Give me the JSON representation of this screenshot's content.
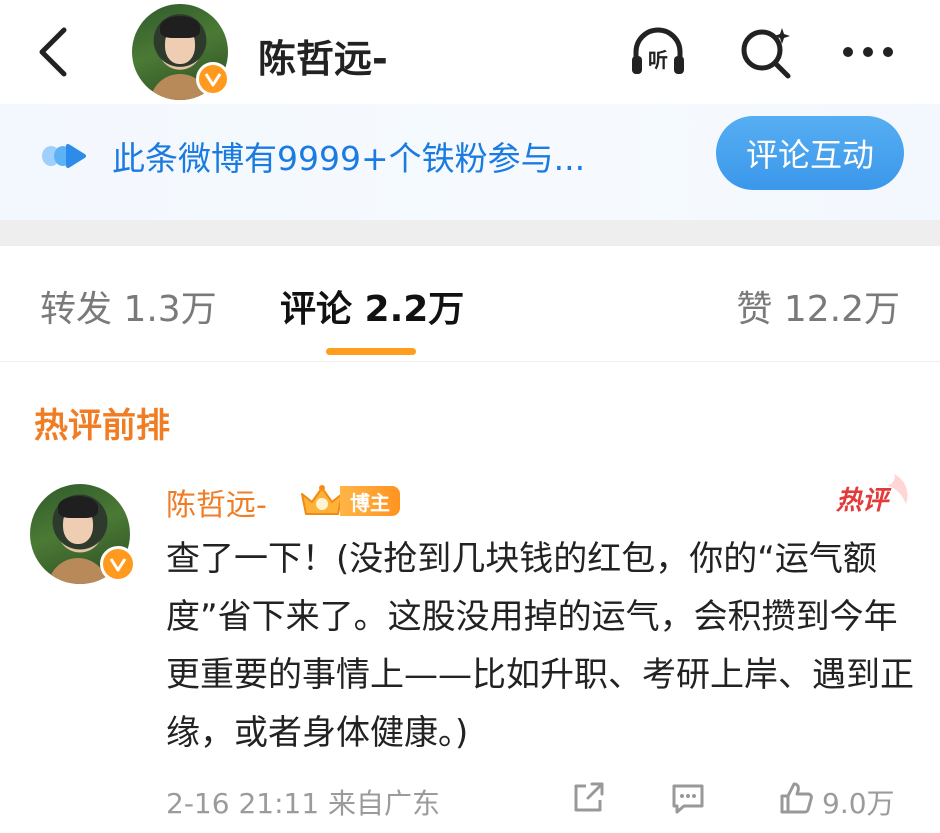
{
  "header": {
    "title": "陈哲远-",
    "listen_label": "听"
  },
  "banner": {
    "text": "此条微博有9999+个铁粉参与...",
    "button_label": "评论互动"
  },
  "tabs": {
    "repost": "转发 1.3万",
    "comment": "评论 2.2万",
    "like": "赞 12.2万"
  },
  "section": {
    "title": "热评前排"
  },
  "comment": {
    "author": "陈哲远-",
    "badge_label": "博主",
    "hot_label": "热评",
    "text": "查了一下！(没抢到几块钱的红包，你的“运气额度”省下来了。这股没用掉的运气，会积攒到今年更重要的事情上——比如升职、考研上岸、遇到正缘，或者身体健康。)",
    "meta": "2-16 21:11  来自广东",
    "like_count": "9.0万"
  },
  "colors": {
    "accent_orange": "#f07c24",
    "link_blue": "#1b7be0",
    "button_blue": "#3b97ea",
    "tab_indicator": "#ff9d1f",
    "verified_badge": "#ff9a1e"
  },
  "icons": [
    "back-icon",
    "listen-icon",
    "search-icon",
    "more-icon",
    "banner-logo-icon",
    "crown-icon",
    "share-icon",
    "reply-icon",
    "like-icon"
  ]
}
